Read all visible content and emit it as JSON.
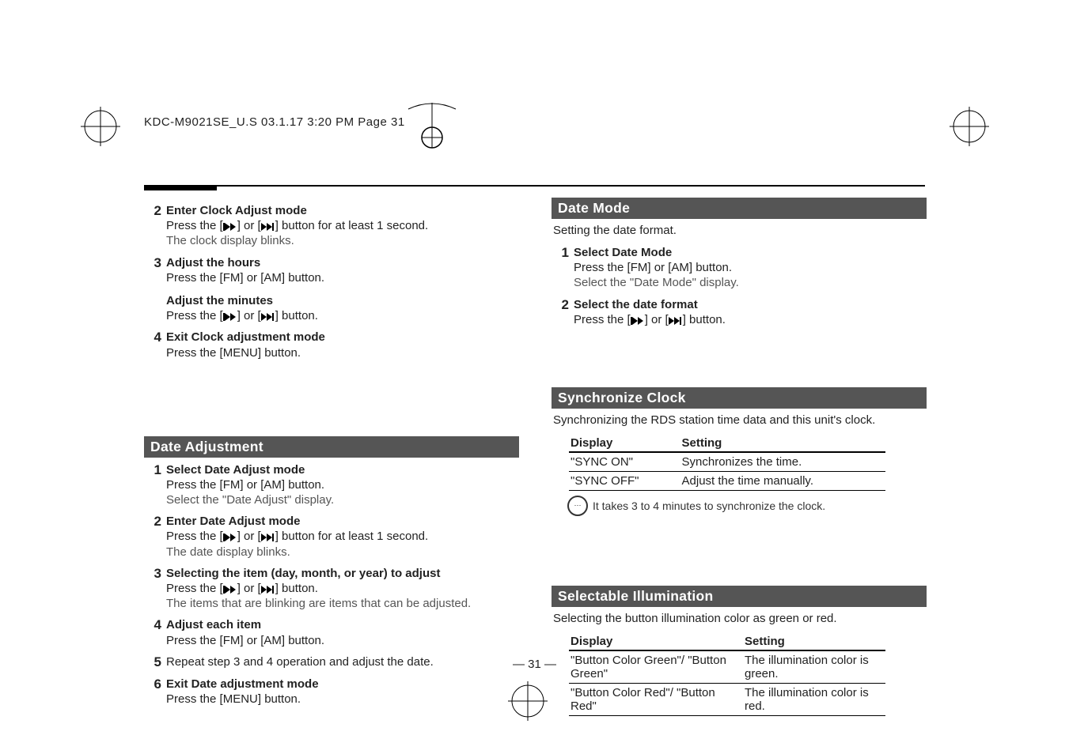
{
  "header": "KDC-M9021SE_U.S  03.1.17  3:20 PM  Page 31",
  "page_number": "— 31 —",
  "left": {
    "s2": {
      "title": "Enter Clock Adjust mode",
      "l1_a": "Press the [",
      "l1_b": "] or [",
      "l1_c": "] button for at least 1 second.",
      "l2": "The clock display blinks."
    },
    "s3": {
      "title": "Adjust the hours",
      "l1": "Press the [FM] or [AM] button.",
      "sub_title": "Adjust the minutes",
      "sub_l_a": "Press the [",
      "sub_l_b": "] or [",
      "sub_l_c": "] button."
    },
    "s4": {
      "title": "Exit Clock adjustment mode",
      "l1": "Press the [MENU] button."
    },
    "dateadj_bar": "Date Adjustment",
    "da1": {
      "title": "Select Date Adjust mode",
      "l1": "Press the [FM] or [AM] button.",
      "l2": "Select the \"Date Adjust\" display."
    },
    "da2": {
      "title": "Enter Date Adjust mode",
      "l1_a": "Press the [",
      "l1_b": "] or [",
      "l1_c": "] button for at least 1 second.",
      "l2": "The date display blinks."
    },
    "da3": {
      "title": "Selecting the item (day, month, or year) to adjust",
      "l1_a": "Press the [",
      "l1_b": "] or [",
      "l1_c": "] button.",
      "l2": "The items that are blinking are items that can be adjusted."
    },
    "da4": {
      "title": "Adjust each item",
      "l1": "Press the [FM] or [AM] button."
    },
    "da5": "Repeat step 3 and 4 operation and adjust the date.",
    "da6": {
      "title": "Exit Date adjustment mode",
      "l1": "Press the [MENU] button."
    }
  },
  "right": {
    "dm_bar": "Date Mode",
    "dm_desc": "Setting the date format.",
    "dm1": {
      "title": "Select Date Mode",
      "l1": "Press the [FM] or [AM] button.",
      "l2": "Select the \"Date Mode\" display."
    },
    "dm2": {
      "title": "Select the date format",
      "l1_a": "Press the [",
      "l1_b": "] or [",
      "l1_c": "] button."
    },
    "sc_bar": "Synchronize Clock",
    "sc_desc": "Synchronizing the RDS station time data and this unit's clock.",
    "sc_th1": "Display",
    "sc_th2": "Setting",
    "sc_r1c1": "\"SYNC ON\"",
    "sc_r1c2": "Synchronizes the time.",
    "sc_r2c1": "\"SYNC OFF\"",
    "sc_r2c2": "Adjust the time manually.",
    "sc_note": "It takes 3 to 4 minutes to synchronize the clock.",
    "si_bar": "Selectable Illumination",
    "si_desc": "Selecting the button illumination color as green or red.",
    "si_th1": "Display",
    "si_th2": "Setting",
    "si_r1c1": "\"Button Color Green\"/ \"Button Green\"",
    "si_r1c2": "The illumination color is green.",
    "si_r2c1": "\"Button Color Red\"/ \"Button Red\"",
    "si_r2c2": "The illumination color is red."
  }
}
